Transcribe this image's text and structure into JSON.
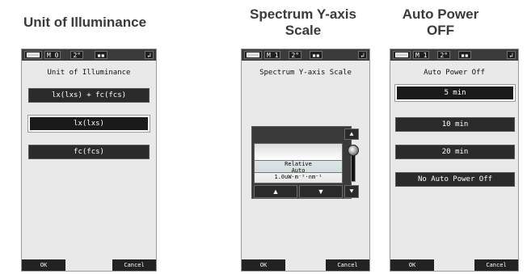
{
  "headings": {
    "col1": "Unit of Illuminance",
    "col2_line1": "Spectrum Y-axis",
    "col2_line2": "Scale",
    "col3_line1": "Auto Power",
    "col3_line2": "OFF"
  },
  "screen1": {
    "status": {
      "mode": "M 0",
      "angle": "2°"
    },
    "title": "Unit of Illuminance",
    "options": [
      "lx(lxs) + fc(fcs)",
      "lx(lxs)",
      "fc(fcs)"
    ],
    "selected_index": 1,
    "ok_label": "OK",
    "cancel_label": "Cancel"
  },
  "screen2": {
    "status": {
      "mode": "M 1",
      "angle": "2°"
    },
    "title": "Spectrum Y-axis Scale",
    "picker_items": [
      "Relative",
      "Auto",
      "1.0uW·m⁻²·nm⁻¹"
    ],
    "selected_item": "Auto",
    "up_arrow": "▲",
    "down_arrow": "▼",
    "top_arrow": "⯅",
    "bottom_arrow": "⯆",
    "ok_label": "OK",
    "cancel_label": "Cancel"
  },
  "screen3": {
    "status": {
      "mode": "M 1",
      "angle": "2°"
    },
    "title": "Auto Power Off",
    "options": [
      "5 min",
      "10 min",
      "20 min",
      "No Auto Power Off"
    ],
    "selected_index": 0,
    "ok_label": "OK",
    "cancel_label": "Cancel"
  }
}
